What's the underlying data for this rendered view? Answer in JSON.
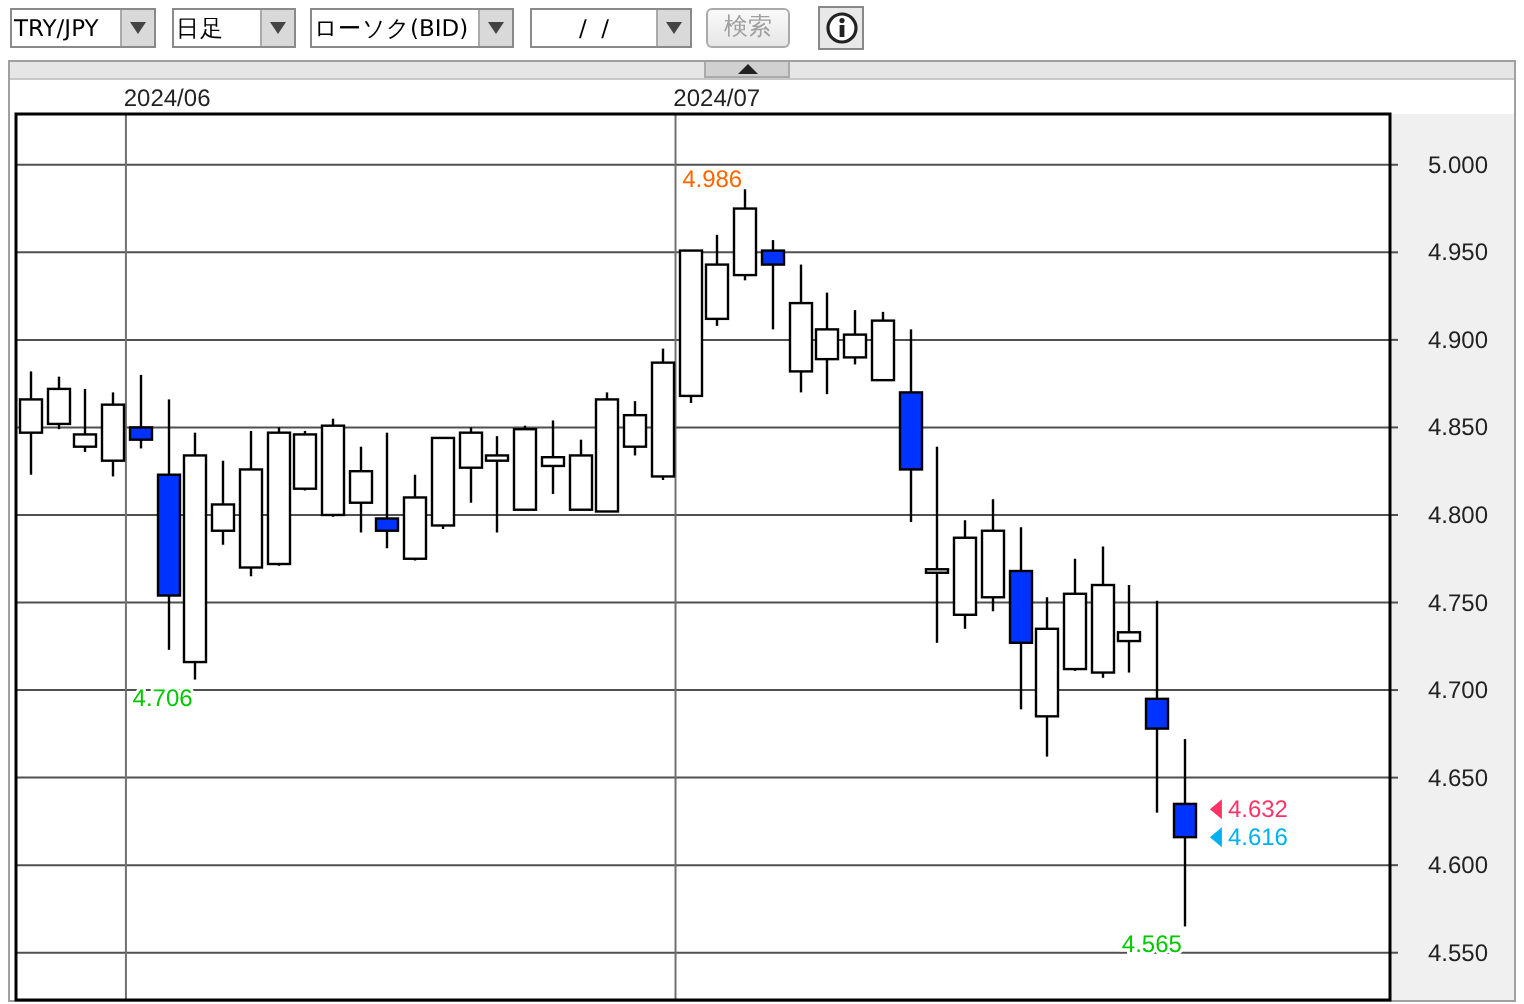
{
  "toolbar": {
    "controls": [
      {
        "kind": "dropdown",
        "value": "TRY/JPY"
      },
      {
        "kind": "dropdown",
        "value": "日足"
      },
      {
        "kind": "dropdown",
        "value": "ローソク(BID)"
      },
      {
        "kind": "date",
        "value": "/  /"
      },
      {
        "kind": "button",
        "label": "検索",
        "disabled": true
      },
      {
        "kind": "info"
      }
    ]
  },
  "chart": {
    "chart_data": {
      "type": "candlestick",
      "grid": true,
      "categories": [
        null,
        null,
        null,
        null,
        null,
        "2024/06",
        null,
        null,
        null,
        null,
        null,
        null,
        null,
        null,
        null,
        null,
        null,
        null,
        null,
        null,
        null,
        null,
        null,
        null,
        null,
        "2024/07",
        null,
        null,
        null,
        null,
        null,
        null,
        null,
        null,
        null,
        null,
        null,
        null,
        null,
        null,
        null,
        null,
        null,
        null,
        null,
        null,
        null,
        null,
        null,
        null
      ],
      "ylim": [
        4.523,
        5.029
      ],
      "yticks": [
        {
          "value": 5.0,
          "label": "5.000"
        },
        {
          "value": 4.95,
          "label": "4.950"
        },
        {
          "value": 4.9,
          "label": "4.900"
        },
        {
          "value": 4.85,
          "label": "4.850"
        },
        {
          "value": 4.8,
          "label": "4.800"
        },
        {
          "value": 4.75,
          "label": "4.750"
        },
        {
          "value": 4.7,
          "label": "4.700"
        },
        {
          "value": 4.65,
          "label": "4.650"
        },
        {
          "value": 4.6,
          "label": "4.600"
        },
        {
          "value": 4.55,
          "label": "4.550"
        }
      ],
      "ohlc": [
        [
          4.847,
          4.882,
          4.823,
          4.866
        ],
        [
          4.852,
          4.879,
          4.849,
          4.872
        ],
        [
          4.839,
          4.872,
          4.836,
          4.846
        ],
        [
          4.831,
          4.87,
          4.822,
          4.863
        ],
        [
          4.85,
          4.88,
          4.838,
          4.843
        ],
        [
          4.823,
          4.866,
          4.723,
          4.754
        ],
        [
          4.716,
          4.847,
          4.706,
          4.834
        ],
        [
          4.791,
          4.831,
          4.783,
          4.806
        ],
        [
          4.77,
          4.848,
          4.765,
          4.826
        ],
        [
          4.772,
          4.85,
          4.771,
          4.847
        ],
        [
          4.815,
          4.848,
          4.814,
          4.846
        ],
        [
          4.8,
          4.855,
          4.799,
          4.851
        ],
        [
          4.807,
          4.839,
          4.79,
          4.825
        ],
        [
          4.798,
          4.847,
          4.781,
          4.791
        ],
        [
          4.775,
          4.823,
          4.774,
          4.81
        ],
        [
          4.794,
          4.844,
          4.792,
          4.844
        ],
        [
          4.827,
          4.85,
          4.807,
          4.847
        ],
        [
          4.831,
          4.845,
          4.79,
          4.834
        ],
        [
          4.803,
          4.851,
          4.803,
          4.849
        ],
        [
          4.828,
          4.854,
          4.812,
          4.833
        ],
        [
          4.803,
          4.843,
          4.803,
          4.834
        ],
        [
          4.802,
          4.87,
          4.802,
          4.866
        ],
        [
          4.839,
          4.865,
          4.834,
          4.857
        ],
        [
          4.822,
          4.895,
          4.82,
          4.887
        ],
        [
          4.868,
          4.951,
          4.864,
          4.951
        ],
        [
          4.912,
          4.96,
          4.908,
          4.943
        ],
        [
          4.937,
          4.986,
          4.934,
          4.975
        ],
        [
          4.951,
          4.957,
          4.906,
          4.943
        ],
        [
          4.882,
          4.943,
          4.87,
          4.921
        ],
        [
          4.889,
          4.927,
          4.869,
          4.906
        ],
        [
          4.89,
          4.917,
          4.886,
          4.903
        ],
        [
          4.877,
          4.916,
          4.877,
          4.911
        ],
        [
          4.87,
          4.906,
          4.796,
          4.826
        ],
        [
          4.767,
          4.839,
          4.727,
          4.769
        ],
        [
          4.743,
          4.797,
          4.735,
          4.787
        ],
        [
          4.753,
          4.809,
          4.745,
          4.791
        ],
        [
          4.768,
          4.793,
          4.689,
          4.727
        ],
        [
          4.685,
          4.753,
          4.662,
          4.735
        ],
        [
          4.712,
          4.775,
          4.711,
          4.755
        ],
        [
          4.71,
          4.782,
          4.707,
          4.76
        ],
        [
          4.728,
          4.76,
          4.71,
          4.733
        ],
        [
          4.695,
          4.751,
          4.63,
          4.678
        ],
        [
          4.635,
          4.672,
          4.565,
          4.616
        ],
        null,
        null,
        null,
        null,
        null,
        null,
        null
      ]
    },
    "price_labels": [
      {
        "kind": "high",
        "text": "4.986",
        "color": "#ff6600"
      },
      {
        "kind": "low",
        "text": "4.706",
        "color": "#00c800"
      },
      {
        "kind": "low",
        "text": "4.565",
        "color": "#00c800"
      },
      {
        "kind": "marker",
        "text": "4.632",
        "color": "#ff3366"
      },
      {
        "kind": "marker",
        "text": "4.616",
        "color": "#00b0f0"
      }
    ]
  }
}
